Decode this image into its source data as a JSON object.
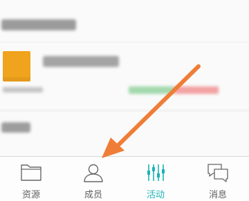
{
  "tabs": [
    {
      "label": "资源",
      "icon": "folder-icon",
      "active": false
    },
    {
      "label": "成员",
      "icon": "person-icon",
      "active": false
    },
    {
      "label": "活动",
      "icon": "activity-bars-icon",
      "active": true
    },
    {
      "label": "消息",
      "icon": "chat-icon",
      "active": false
    }
  ],
  "colors": {
    "accent": "#1eb3b5",
    "arrow": "#f07d37",
    "thumbnail": "#f0a31c",
    "tag_green": "#5dbf70",
    "tag_red": "#ec5b5b"
  }
}
